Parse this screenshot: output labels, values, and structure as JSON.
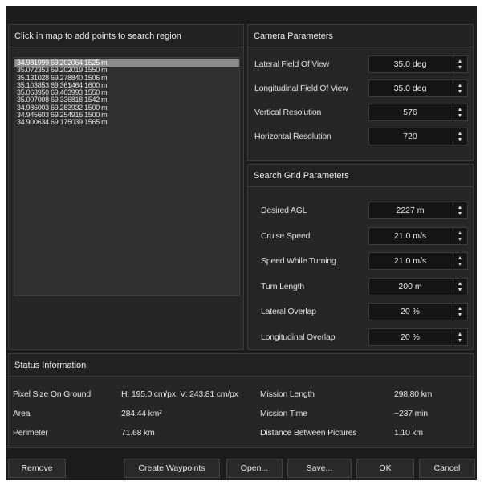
{
  "points_panel": {
    "title": "Click in map to add points to search region",
    "points": [
      "34.981999 69.202064 1525 m",
      "35.072353 69.202019 1550 m",
      "35.131028 69.278840 1506 m",
      "35.103853 69.361464 1600 m",
      "35.063950 69.403993 1550 m",
      "35.007008 69.336818 1542 m",
      "34.986003 69.283932 1500 m",
      "34.945603 69.254916 1500 m",
      "34.900634 69.175039 1565 m"
    ],
    "selected_index": 0
  },
  "camera": {
    "title": "Camera Parameters",
    "fields": [
      {
        "label": "Lateral Field Of View",
        "value": "35.0 deg"
      },
      {
        "label": "Longitudinal Field Of View",
        "value": "35.0 deg"
      },
      {
        "label": "Vertical Resolution",
        "value": "576"
      },
      {
        "label": "Horizontal Resolution",
        "value": "720"
      }
    ]
  },
  "grid": {
    "title": "Search Grid Parameters",
    "fields": [
      {
        "label": "Desired AGL",
        "value": "2227 m"
      },
      {
        "label": "Cruise Speed",
        "value": "21.0 m/s"
      },
      {
        "label": "Speed While Turning",
        "value": "21.0 m/s"
      },
      {
        "label": "Turn Length",
        "value": "200 m"
      },
      {
        "label": "Lateral Overlap",
        "value": "20 %"
      },
      {
        "label": "Longitudinal Overlap",
        "value": "20 %"
      }
    ]
  },
  "status": {
    "title": "Status Information",
    "left": [
      {
        "label": "Pixel Size On Ground",
        "value": "H: 195.0 cm/px, V: 243.81 cm/px"
      },
      {
        "label": "Area",
        "value": "284.44 km²"
      },
      {
        "label": "Perimeter",
        "value": "71.68 km"
      }
    ],
    "right": [
      {
        "label": "Mission Length",
        "value": "298.80 km"
      },
      {
        "label": "Mission Time",
        "value": "~237 min"
      },
      {
        "label": "Distance Between Pictures",
        "value": "1.10 km"
      }
    ]
  },
  "buttons": {
    "remove": "Remove",
    "create_waypoints": "Create Waypoints",
    "open": "Open...",
    "save": "Save...",
    "ok": "OK",
    "cancel": "Cancel"
  }
}
